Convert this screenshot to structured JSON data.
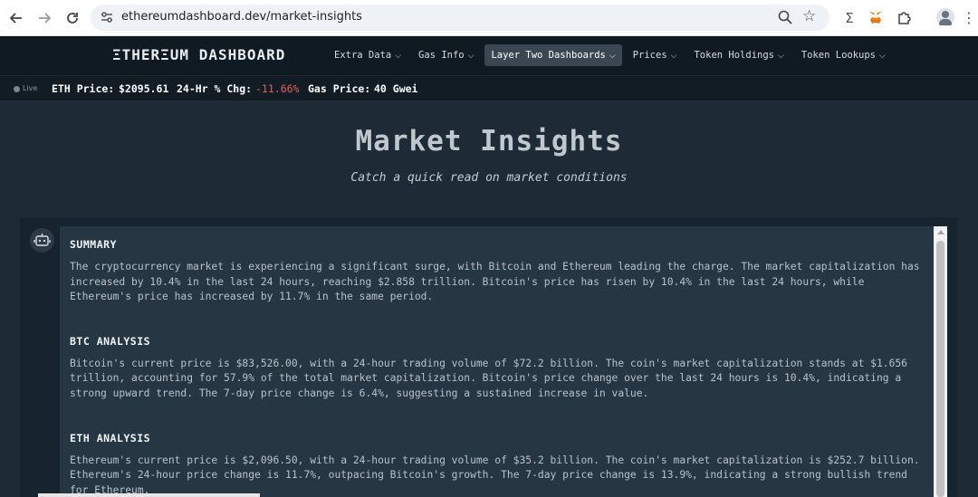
{
  "browser": {
    "url": "ethereumdashboard.dev/market-insights",
    "icons": [
      "back-icon",
      "forward-icon",
      "reload-icon",
      "site-settings-icon",
      "zoom-icon",
      "bookmark-star-icon",
      "sigma-extension-icon",
      "metamask-icon",
      "extensions-puzzle-icon",
      "profile-icon",
      "menu-kebab-icon"
    ]
  },
  "header": {
    "brand": "ΞTHERΞUM DASHBOARD",
    "menu": [
      {
        "label": "Extra Data"
      },
      {
        "label": "Gas Info"
      },
      {
        "label": "Layer Two Dashboards",
        "active": true
      },
      {
        "label": "Prices"
      },
      {
        "label": "Token Holdings"
      },
      {
        "label": "Token Lookups"
      }
    ]
  },
  "ticker": {
    "live_label": "Live",
    "eth_price_label": "ETH Price:",
    "eth_price": "$2095.61",
    "change_label": "24-Hr % Chg:",
    "change_value": "-11.66%",
    "gas_label": "Gas Price:",
    "gas_value": "40 Gwei"
  },
  "hero": {
    "title": "Market Insights",
    "subtitle": "Catch a quick read on market conditions"
  },
  "insights": {
    "bot_icon": "robot-icon",
    "sections": [
      {
        "title": "SUMMARY",
        "body": "The cryptocurrency market is experiencing a significant surge, with Bitcoin and Ethereum leading the charge. The market capitalization has increased by 10.4% in the last 24 hours, reaching $2.858 trillion. Bitcoin's price has risen by 10.4% in the last 24 hours, while Ethereum's price has increased by 11.7% in the same period."
      },
      {
        "title": "BTC ANALYSIS",
        "body": "Bitcoin's current price is $83,526.00, with a 24-hour trading volume of $72.2 billion. The coin's market capitalization stands at $1.656 trillion, accounting for 57.9% of the total market capitalization. Bitcoin's price change over the last 24 hours is 10.4%, indicating a strong upward trend. The 7-day price change is 6.4%, suggesting a sustained increase in value."
      },
      {
        "title": "ETH ANALYSIS",
        "body": "Ethereum's current price is $2,096.50, with a 24-hour trading volume of $35.2 billion. The coin's market capitalization is $252.7 billion. Ethereum's 24-hour price change is 11.7%, outpacing Bitcoin's growth. The 7-day price change is 13.9%, indicating a strong bullish trend for Ethereum."
      }
    ]
  },
  "colors": {
    "page_bg": "#1e2b36",
    "nav_bg": "#0f1a23",
    "negative": "#e06060"
  }
}
